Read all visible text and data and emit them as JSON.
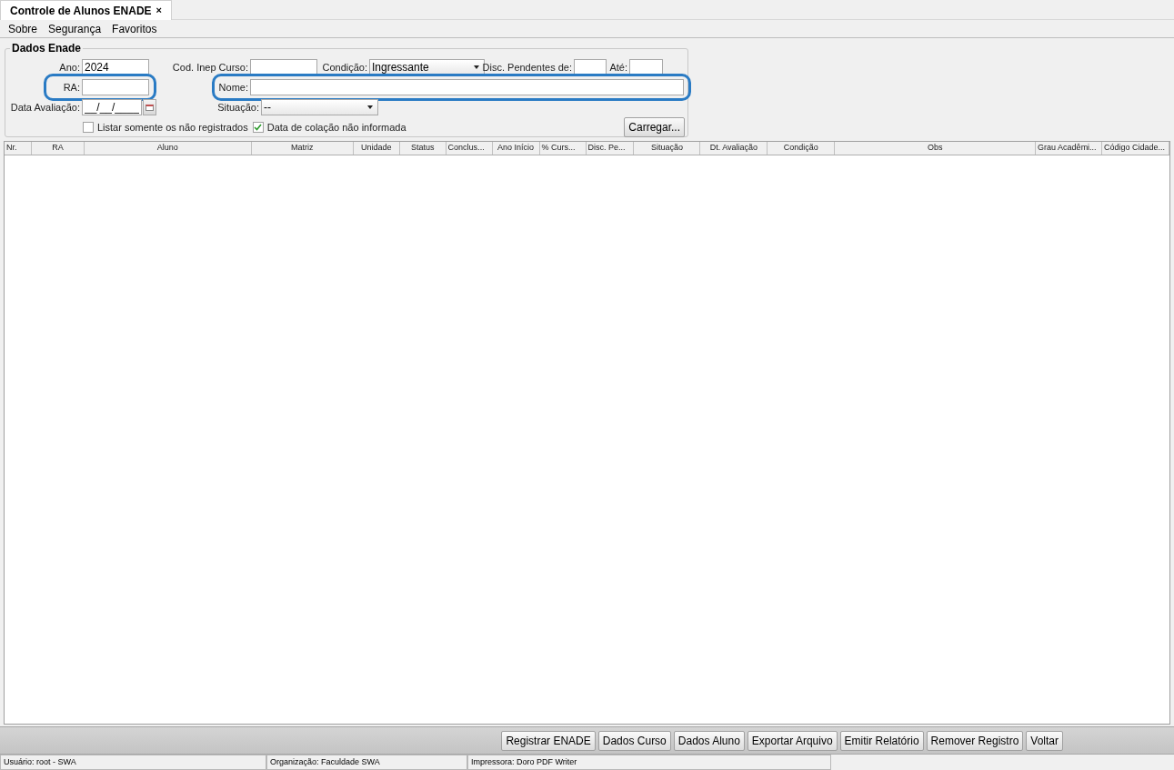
{
  "tabs": [
    {
      "label": "Controle de Alunos ENADE",
      "close": "×",
      "selected": true
    }
  ],
  "menu": [
    "Sobre",
    "Segurança",
    "Favoritos"
  ],
  "form": {
    "title": "Dados Enade",
    "rows": [
      [
        {
          "label": "Ano:",
          "kind": "text",
          "value": "2024"
        },
        {
          "label": "Cod. Inep Curso:",
          "kind": "text"
        },
        {
          "label": "Condição:",
          "kind": "select",
          "value": "Ingressante"
        },
        {
          "label": "Disc. Pendentes de:",
          "kind": "text"
        },
        {
          "label": "Até:",
          "kind": "text"
        }
      ],
      [
        {
          "label": "RA:",
          "kind": "text",
          "highlighted": true
        },
        {
          "label": "Nome:",
          "kind": "text",
          "highlighted": true
        }
      ],
      [
        {
          "label": "Data Avaliação:",
          "kind": "date",
          "value": "__/__/____"
        },
        {
          "label": "Situação:",
          "kind": "select",
          "value": "--"
        }
      ]
    ],
    "checkboxes": [
      {
        "label": "Listar somente os não registrados",
        "checked": false
      },
      {
        "label": "Data de colação não informada",
        "checked": true
      }
    ],
    "load_button": "Carregar..."
  },
  "table": {
    "columns": [
      "Nr.",
      "RA",
      "Aluno",
      "Matriz",
      "Unidade",
      "Status",
      "Conclus...",
      "Ano Início",
      "% Curs...",
      "Disc. Pe...",
      "Situação",
      "Dt. Avaliação",
      "Condição",
      "Obs",
      "Grau Acadêmi...",
      "Código Cidade..."
    ]
  },
  "buttons": [
    "Registrar ENADE",
    "Dados Curso",
    "Dados Aluno",
    "Exportar Arquivo",
    "Emitir Relatório",
    "Remover Registro",
    "Voltar"
  ],
  "status_bar": [
    "Usuário: root - SWA",
    "Organização: Faculdade SWA",
    "Impressora: Doro PDF Writer"
  ]
}
